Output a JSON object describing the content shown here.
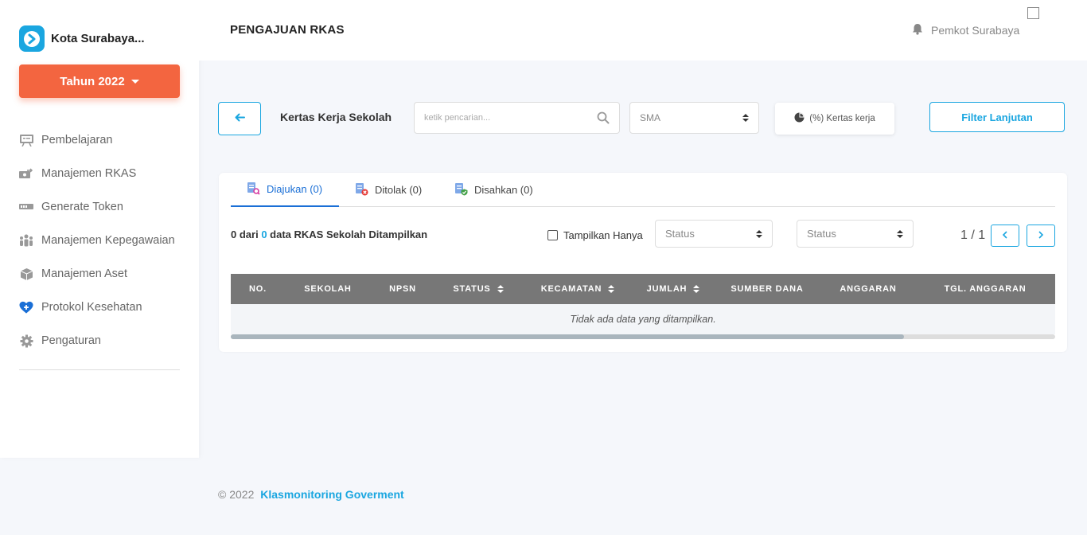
{
  "brand": {
    "name": "Kota Surabaya..."
  },
  "year_button": {
    "label": "Tahun 2022"
  },
  "sidebar": {
    "items": [
      {
        "label": "Pembelajaran",
        "icon": "presentation-board-icon"
      },
      {
        "label": "Manajemen RKAS",
        "icon": "money-transfer-icon"
      },
      {
        "label": "Generate Token",
        "icon": "ticket-token-icon"
      },
      {
        "label": "Manajemen Kepegawaian",
        "icon": "people-group-icon"
      },
      {
        "label": "Manajemen Aset",
        "icon": "box-icon"
      },
      {
        "label": "Protokol Kesehatan",
        "icon": "heart-plus-icon"
      },
      {
        "label": "Pengaturan",
        "icon": "gear-icon"
      }
    ]
  },
  "header": {
    "title": "PENGAJUAN RKAS",
    "user": "Pemkot Surabaya"
  },
  "toolbar": {
    "section_title": "Kertas Kerja Sekolah",
    "search_placeholder": "ketik pencarian...",
    "level_select": "SMA",
    "kertas_kerja_label": "(%) Kertas kerja",
    "filter_label": "Filter Lanjutan"
  },
  "tabs": [
    {
      "label": "Diajukan (0)",
      "icon": "document-search-icon"
    },
    {
      "label": "Ditolak (0)",
      "icon": "document-rejected-icon"
    },
    {
      "label": "Disahkan (0)",
      "icon": "document-approved-icon"
    }
  ],
  "listing": {
    "shown": "0",
    "text_mid": " dari ",
    "total": "0",
    "text_end": " data RKAS Sekolah Ditampilkan",
    "checkbox_label": "Tampilkan Hanya",
    "status_select_1": "Status",
    "status_select_2": "Status",
    "pager": "1 / 1"
  },
  "table": {
    "columns": [
      {
        "label": "NO.",
        "sortable": false
      },
      {
        "label": "SEKOLAH",
        "sortable": false
      },
      {
        "label": "NPSN",
        "sortable": false
      },
      {
        "label": "STATUS",
        "sortable": true
      },
      {
        "label": "KECAMATAN",
        "sortable": true
      },
      {
        "label": "JUMLAH",
        "sortable": true
      },
      {
        "label": "SUMBER DANA",
        "sortable": false
      },
      {
        "label": "ANGGARAN",
        "sortable": false
      },
      {
        "label": "TGL. ANGGARAN",
        "sortable": false
      }
    ],
    "empty_message": "Tidak ada data yang ditampilkan."
  },
  "footer": {
    "copyright": "© 2022",
    "company": "Klasmonitoring Goverment"
  },
  "colors": {
    "accent": "#1aa6e0",
    "year_button": "#f36540",
    "active_tab": "#1a6fd6",
    "table_header": "#777777"
  }
}
